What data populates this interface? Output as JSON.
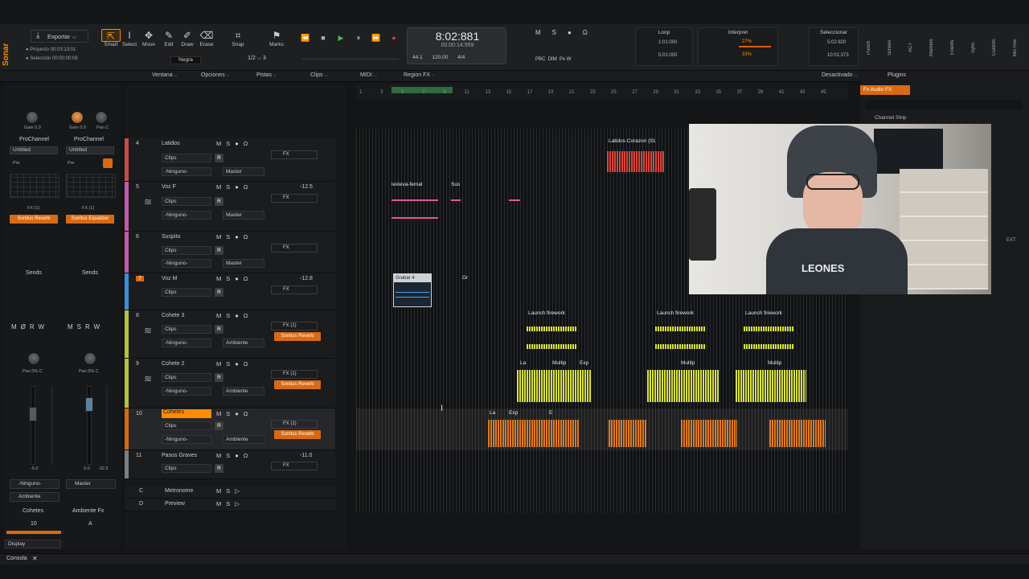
{
  "app": {
    "brand": "Sonar"
  },
  "toolbar": {
    "project_label": "Proyecto",
    "project_time": "00:03:13:01",
    "selection_label": "Selección",
    "selection_time": "00:00:00:08",
    "export_label": "Exportar",
    "tools": [
      "Smart",
      "Select",
      "Move",
      "Edit",
      "Draw",
      "Erase"
    ],
    "snap_label": "Snap",
    "marks_label": "Marks",
    "snap_value": "1/2",
    "snap_value_2": "3",
    "snap_mode": "Negra",
    "time_main": "8:02:881",
    "time_sub": "00:00:14:959",
    "tempo_top": "44.1",
    "tempo_bottom": "24",
    "bpm": "120.00",
    "meter": "4/4",
    "pbc": "PBC",
    "dim": "DIM",
    "loop_label": "Loop",
    "loop_start": "1:01:000",
    "loop_end": "5:01:000",
    "interpret_label": "Interpret",
    "interpret_pct1": "27%",
    "interpret_pct2": "33%",
    "select_label": "Seleccionar",
    "select_start": "5:02:820",
    "select_end": "10:01:373",
    "right_labels": [
      "Punch",
      "Screen",
      "ACT",
      "Markers",
      "Events",
      "Sync",
      "Custom",
      "Mix Rec"
    ]
  },
  "menubar": {
    "items": [
      "Ventana",
      "Opciones",
      "Pistas",
      "Clips",
      "MIDI",
      "Region FX"
    ],
    "deactivate": "Desactivado",
    "plugins": "Plugins"
  },
  "inspector": {
    "knobs_left": [
      "Gain 0.0",
      "Gain 0.0",
      "Pan C"
    ],
    "prochannel": "ProChannel",
    "untitled": "Untitled",
    "pre": "Pre",
    "fx_label": "FX (1)",
    "fx_left": "Sonitus Reverb",
    "fx_right": "Sonitus Equalizer",
    "sends": "Sends",
    "pan_left": "Pan 0% C",
    "pan_right": "Pan 0% C",
    "vol_left": "-5.0",
    "vol_right_a": "0.0",
    "vol_right_b": "-32.5",
    "out_left": "-Ninguno-",
    "out_right": "Master",
    "out_left_2": "Ambiente",
    "name_left": "Cohetes",
    "name_right": "Ambiente Fx",
    "num_left": "10",
    "num_right": "A",
    "display": "Display"
  },
  "tracks": [
    {
      "num": "4",
      "name": "Latidos",
      "input": "-Ninguno-",
      "output": "Master",
      "fx": "FX",
      "vol": "",
      "color": "#c54b4b"
    },
    {
      "num": "5",
      "name": "Voz F",
      "input": "-Ninguno-",
      "output": "Master",
      "fx": "FX",
      "vol": "-12.5",
      "color": "#c05aa8"
    },
    {
      "num": "6",
      "name": "Suspito",
      "input": "-Ninguno-",
      "output": "Master",
      "fx": "FX",
      "vol": "",
      "color": "#c05aa8"
    },
    {
      "num": "7",
      "name": "Voz M",
      "input": "",
      "output": "",
      "fx": "FX",
      "vol": "-12.8",
      "color": "#3a8fd8"
    },
    {
      "num": "8",
      "name": "Cohete 3",
      "input": "-Ninguno-",
      "output": "Ambiente",
      "fx": "FX (1)",
      "reverb": "Sonitus Reverb",
      "vol": "",
      "color": "#b6c23a"
    },
    {
      "num": "9",
      "name": "Cohete 2",
      "input": "-Ninguno-",
      "output": "Ambiente",
      "fx": "FX (1)",
      "reverb": "Sonitus Reverb",
      "vol": "",
      "color": "#b6c23a"
    },
    {
      "num": "10",
      "name": "Cohetes",
      "input": "-Ninguno-",
      "output": "Ambiente",
      "fx": "FX (1)",
      "reverb": "Sonitus Reverb",
      "vol": "",
      "color": "#d86a12"
    },
    {
      "num": "11",
      "name": "Pasos Graves",
      "input": "",
      "output": "",
      "fx": "FX",
      "vol": "-11.0",
      "color": "#7a7f85"
    }
  ],
  "clips_label": "Clips",
  "bus": [
    {
      "letter": "C",
      "name": "Metronome"
    },
    {
      "letter": "D",
      "name": "Preview"
    }
  ],
  "ruler_ticks": [
    "1",
    "3",
    "5",
    "7",
    "9",
    "11",
    "13",
    "15",
    "17",
    "19",
    "21",
    "23",
    "25",
    "27",
    "29",
    "31",
    "33",
    "35",
    "37",
    "39",
    "41",
    "43",
    "45"
  ],
  "clips": {
    "latidos": "Latidos Corazon (91",
    "voz": "lexieva-femal",
    "sus": "Sus",
    "grabar": "Grabar 4",
    "grr": "Gr",
    "launch": "Launch firework",
    "multi": "Multip",
    "exp": "Exp",
    "la": "La",
    "e": "E"
  },
  "browser": {
    "tab": "Plugins",
    "fx_audio": "Fx Audio FX",
    "channel_strip": "Channel Strip",
    "ext": "EXT"
  },
  "webcam": {
    "shirt_text": "LEONES"
  },
  "console": {
    "label": "Consola"
  }
}
